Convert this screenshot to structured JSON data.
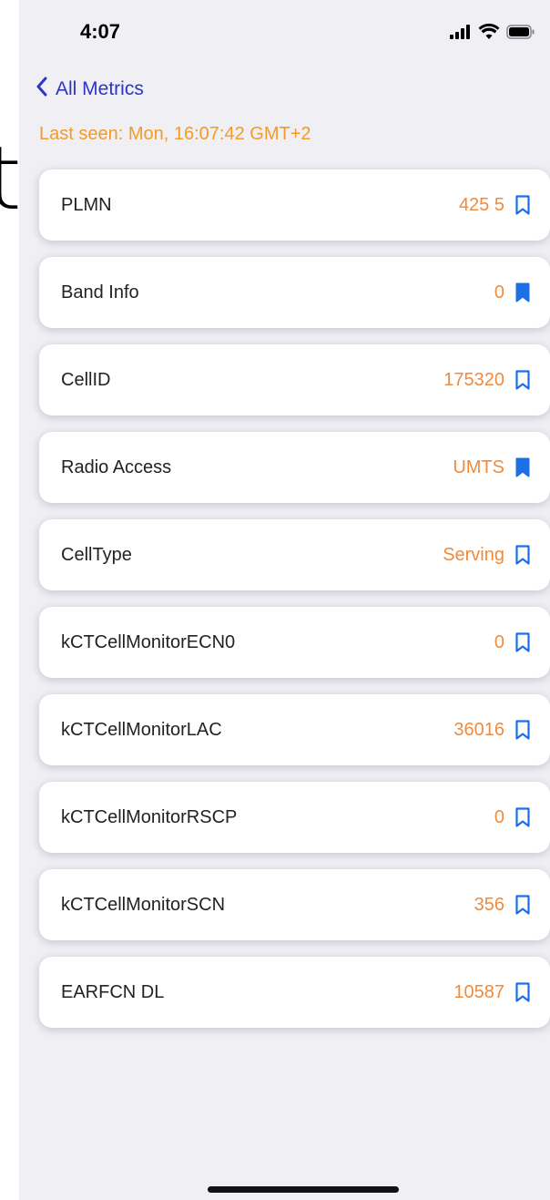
{
  "background_glyph": "t",
  "status_bar": {
    "time": "4:07",
    "icons": [
      "cellular-signal-icon",
      "wifi-icon",
      "battery-icon"
    ]
  },
  "nav": {
    "back_label": "All Metrics",
    "back_icon": "chevron-left-icon"
  },
  "last_seen": "Last seen: Mon, 16:07:42 GMT+2",
  "colors": {
    "accent": "#2b36c9",
    "value": "#f08a3c",
    "last_seen": "#f39a28",
    "bookmark": "#1e6fe6",
    "background": "#efeff4"
  },
  "metrics": [
    {
      "label": "PLMN",
      "value": "425 5",
      "bookmarked": false
    },
    {
      "label": "Band Info",
      "value": "0",
      "bookmarked": true
    },
    {
      "label": "CellID",
      "value": "175320",
      "bookmarked": false
    },
    {
      "label": "Radio Access",
      "value": "UMTS",
      "bookmarked": true
    },
    {
      "label": "CellType",
      "value": "Serving",
      "bookmarked": false
    },
    {
      "label": "kCTCellMonitorECN0",
      "value": "0",
      "bookmarked": false
    },
    {
      "label": "kCTCellMonitorLAC",
      "value": "36016",
      "bookmarked": false
    },
    {
      "label": "kCTCellMonitorRSCP",
      "value": "0",
      "bookmarked": false
    },
    {
      "label": "kCTCellMonitorSCN",
      "value": "356",
      "bookmarked": false
    },
    {
      "label": "EARFCN DL",
      "value": "10587",
      "bookmarked": false
    }
  ]
}
